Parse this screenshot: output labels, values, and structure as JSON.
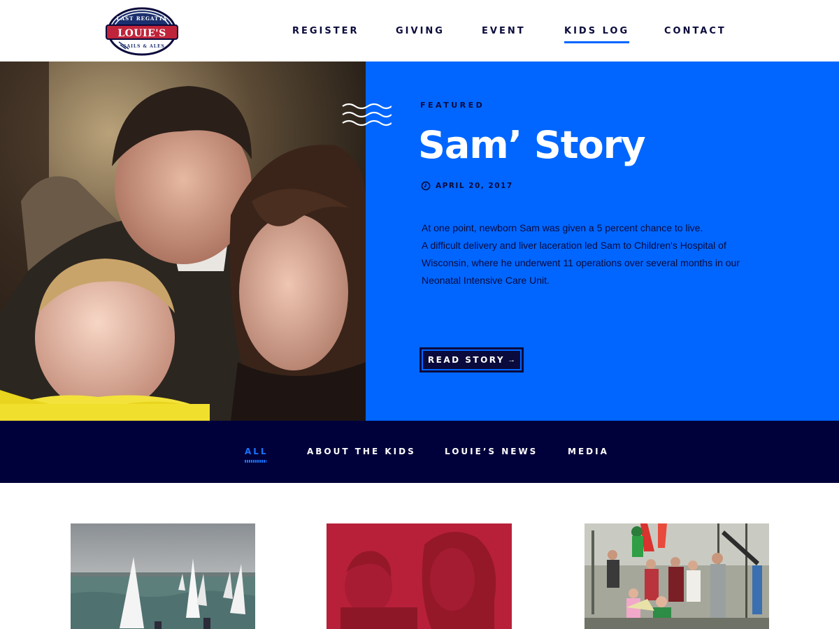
{
  "header": {
    "logo": {
      "top_text": "LAST REGATTA",
      "main_text": "LOUIE'S",
      "bottom_text": "SAILS & ALES"
    },
    "nav": [
      {
        "label": "REGISTER"
      },
      {
        "label": "GIVING"
      },
      {
        "label": "EVENT"
      },
      {
        "label": "KIDS LOG",
        "active": true
      },
      {
        "label": "CONTACT"
      }
    ]
  },
  "hero": {
    "eyebrow": "FEATURED",
    "title": "Sam’ Story",
    "date": "APRIL 20, 2017",
    "excerpt_line1": "At one point, newborn Sam was given a 5 percent chance to live.",
    "excerpt_line2": "A difficult delivery and liver laceration led Sam to Children's Hospital of Wisconsin, where he underwent 11 operations over several months in our Neonatal Intensive Care Unit.",
    "cta_label": "READ STORY",
    "panel_color": "#0066ff"
  },
  "filters": {
    "items": [
      {
        "label": "ALL",
        "active": true
      },
      {
        "label": "ABOUT THE KIDS"
      },
      {
        "label": "LOUIE’S NEWS"
      },
      {
        "label": "MEDIA"
      }
    ],
    "bar_color": "#00003a",
    "active_color": "#1a73ff"
  },
  "cards": [
    {
      "image": "sailboats-photo"
    },
    {
      "image": "child-and-mother-photo-red-tint",
      "tint": "#b8203a"
    },
    {
      "image": "costumed-group-photo"
    }
  ],
  "colors": {
    "navy": "#0a0a3c",
    "brand_blue": "#0066ff",
    "logo_red": "#c0243a"
  }
}
